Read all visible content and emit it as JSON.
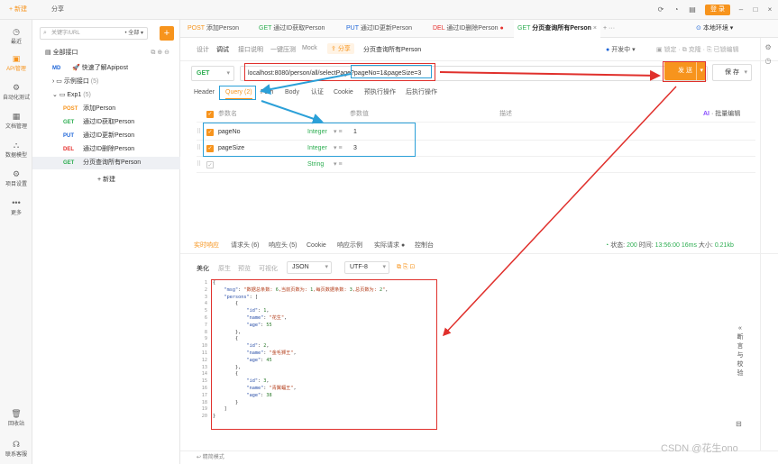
{
  "topbar": {
    "new_label": "+ 新建",
    "share_label": "分享",
    "login_label": "登 录"
  },
  "nav": [
    {
      "icon": "history-icon",
      "label": "最近"
    },
    {
      "icon": "api-icon",
      "label": "API管理"
    },
    {
      "icon": "auto-test-icon",
      "label": "自动化测试"
    },
    {
      "icon": "doc-icon",
      "label": "文档管理"
    },
    {
      "icon": "model-icon",
      "label": "数据模型"
    },
    {
      "icon": "settings-icon",
      "label": "项目设置"
    },
    {
      "icon": "more-icon",
      "label": "更多"
    },
    {
      "icon": "trash-icon",
      "label": "回收站"
    },
    {
      "icon": "support-icon",
      "label": "联系客服"
    }
  ],
  "tree": {
    "search_placeholder": "关键字/URL",
    "filter": "全部",
    "root": "全部接口",
    "quick": {
      "method": "MD",
      "label": "快速了解Apipost"
    },
    "example": {
      "label": "示例接口",
      "count": "(5)"
    },
    "folder": {
      "label": "Exp1",
      "count": "(5)"
    },
    "items": [
      {
        "method": "POST",
        "label": "添加Person"
      },
      {
        "method": "GET",
        "label": "通过ID获取Person"
      },
      {
        "method": "PUT",
        "label": "通过ID更新Person"
      },
      {
        "method": "DEL",
        "label": "通过ID删除Person"
      },
      {
        "method": "GET",
        "label": "分页查询所有Person"
      }
    ],
    "new_label": "+ 新建"
  },
  "tabs": [
    {
      "method": "POST",
      "label": "添加Person"
    },
    {
      "method": "GET",
      "label": "通过ID获取Person"
    },
    {
      "method": "PUT",
      "label": "通过ID更新Person"
    },
    {
      "method": "DEL",
      "label": "通过ID删除Person"
    },
    {
      "method": "GET",
      "label": "分页查询所有Person"
    }
  ],
  "env": "本地环境",
  "subbar": {
    "design": "设计",
    "debug": "调试",
    "doc": "接口说明",
    "preview": "一键压测",
    "mock": "Mock",
    "share": "分享",
    "title": "分页查询所有Person",
    "status": "开发中"
  },
  "request": {
    "method": "GET",
    "url": "localhost:8080/person/all/selectPage?pageNo=1&pageSize=3",
    "send": "发 送",
    "save": "保 存"
  },
  "req_tabs": [
    "Header",
    "Query (2)",
    "Path",
    "Body",
    "认证",
    "Cookie",
    "预执行操作",
    "后执行操作"
  ],
  "params": {
    "headers": [
      "参数名",
      "参数值",
      "描述"
    ],
    "batch": "批量编辑",
    "rows": [
      {
        "name": "pageNo",
        "type": "Integer",
        "value": "1"
      },
      {
        "name": "pageSize",
        "type": "Integer",
        "value": "3"
      },
      {
        "name": "",
        "type": "String",
        "value": ""
      }
    ]
  },
  "resp_tabs": [
    "实时响应",
    "请求头 (6)",
    "响应头 (5)",
    "Cookie",
    "响应示例",
    "实际请求 ●",
    "控制台"
  ],
  "resp_status": {
    "label": "状态:",
    "code": "200",
    "time_label": "时间:",
    "time": "13:56:00",
    "dur": "16ms",
    "size_label": "大小:",
    "size": "0.21kb"
  },
  "view_tabs": [
    "美化",
    "原生",
    "预览",
    "可视化",
    "JSON",
    "UTF-8"
  ],
  "code_lines": [
    "{",
    "    \"msg\": \"数据总条数: 6,当前页数为: 1,每页数据条数: 3,总页数为: 2\",",
    "    \"persons\": [",
    "        {",
    "            \"id\": 1,",
    "            \"name\": \"花生\",",
    "            \"age\": 55",
    "        },",
    "        {",
    "            \"id\": 2,",
    "            \"name\": \"金毛狮王\",",
    "            \"age\": 45",
    "        },",
    "        {",
    "            \"id\": 3,",
    "            \"name\": \"青翼蝠王\",",
    "            \"age\": 38",
    "        }",
    "    ]",
    "}"
  ],
  "sidepanel": "断言与校验",
  "bottom": {
    "mode": "精简模式"
  },
  "watermark": "CSDN @花生ono"
}
